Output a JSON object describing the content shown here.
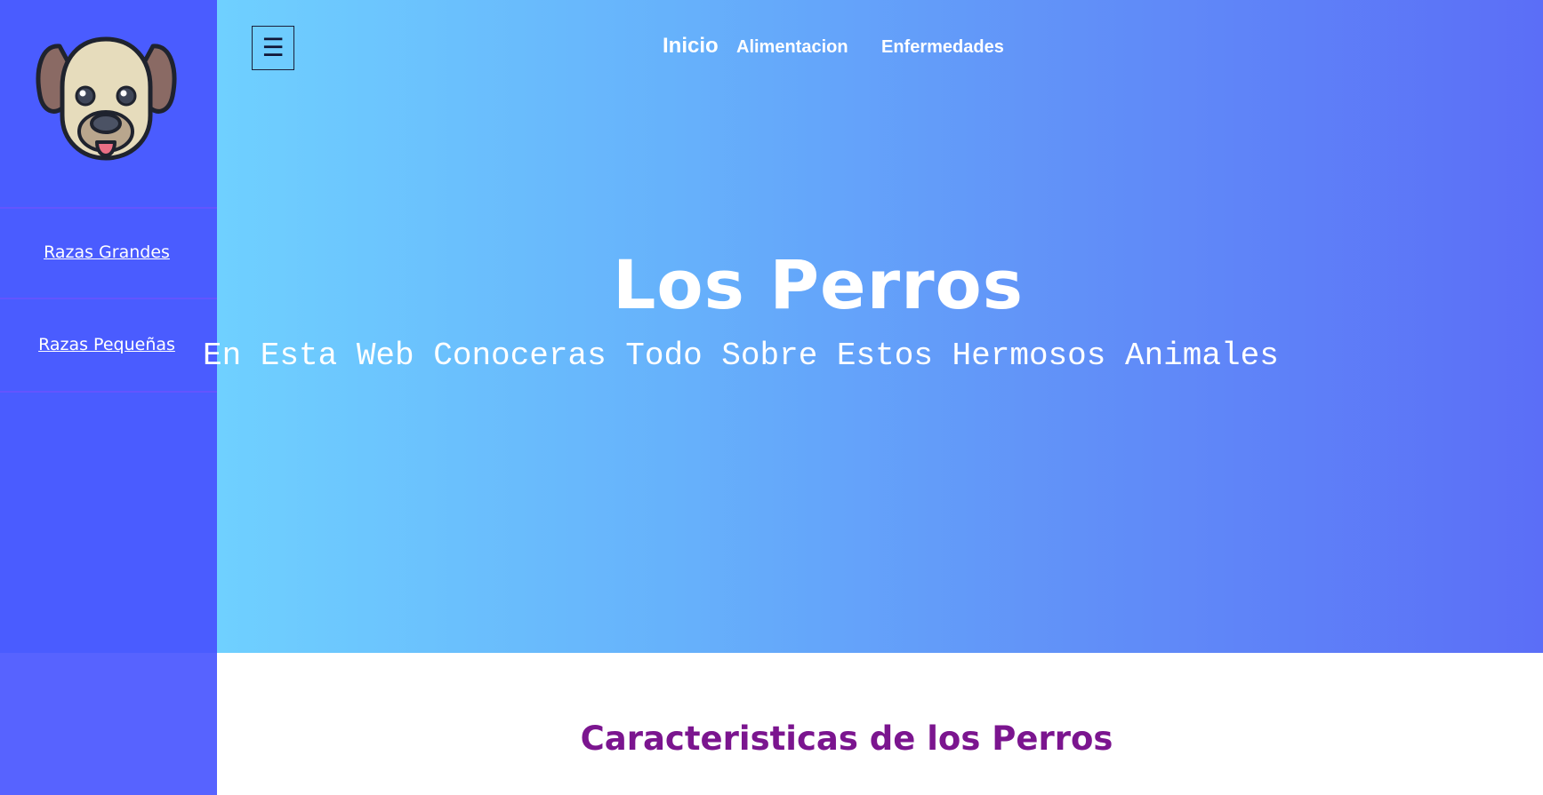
{
  "sidebar": {
    "logo_icon": "dog-face-icon",
    "items": [
      {
        "label": "Razas Grandes"
      },
      {
        "label": "Razas Pequeñas"
      }
    ],
    "colors": {
      "background": "#4a5cff",
      "lower": "#5763ff"
    }
  },
  "header": {
    "menu_icon": "hamburger-menu-icon",
    "menu_glyph": "☰",
    "nav": [
      {
        "label": "Inicio"
      },
      {
        "label": "Alimentacion"
      },
      {
        "label": "Enfermedades"
      }
    ]
  },
  "hero": {
    "title": "Los Perros",
    "subtitle": "En Esta Web Conoceras Todo Sobre Estos Hermosos Animales",
    "gradient": [
      "#6fd0ff",
      "#5b6ef7"
    ]
  },
  "main": {
    "section_title": "Caracteristicas de los Perros",
    "section_title_color": "#7b158f"
  }
}
